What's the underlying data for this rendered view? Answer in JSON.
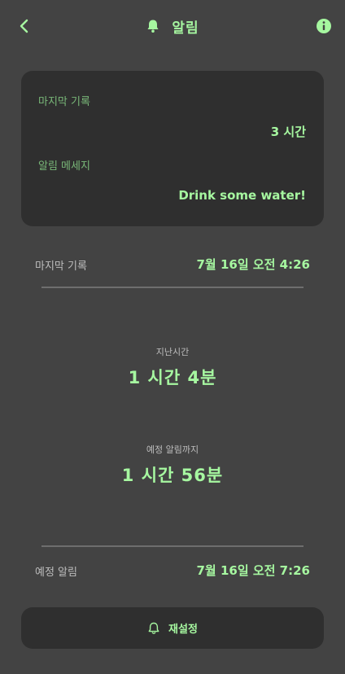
{
  "header": {
    "title": "알림",
    "back_icon": "chevron-left-icon",
    "bell_icon": "bell-icon",
    "info_icon": "info-icon"
  },
  "card": {
    "last_record_label": "마지막 기록",
    "last_record_value": "3 시간",
    "message_label": "알림 메세지",
    "message_value": "Drink some water!"
  },
  "last_record": {
    "label": "마지막 기록",
    "value": "7월 16일  오전 4:26"
  },
  "elapsed": {
    "label": "지난시간",
    "value": "1 시간 4분"
  },
  "until_next": {
    "label": "예정 알림까지",
    "value": "1 시간 56분"
  },
  "scheduled": {
    "label": "예정 알림",
    "value": "7월 16일  오전 7:26"
  },
  "reset_button": {
    "label": "재설정",
    "icon": "bell-outline-icon"
  },
  "colors": {
    "background": "#434343",
    "card": "#2f2f2f",
    "accent": "#a6f7a0",
    "muted_accent": "#79b878",
    "label": "#bdbdbd",
    "divider": "#6e6e6e"
  }
}
